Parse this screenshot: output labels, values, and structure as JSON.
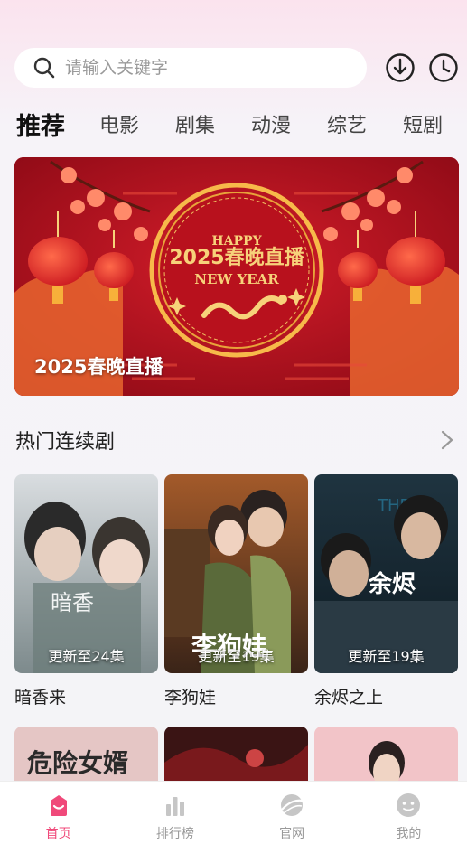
{
  "search": {
    "placeholder": "请输入关键字"
  },
  "tabs": [
    {
      "label": "推荐"
    },
    {
      "label": "电影"
    },
    {
      "label": "剧集"
    },
    {
      "label": "动漫"
    },
    {
      "label": "综艺"
    },
    {
      "label": "短剧"
    }
  ],
  "banner": {
    "caption": "2025春晚直播",
    "art_top": "HAPPY",
    "art_main": "2025春晚直播",
    "art_sub": "NEW YEAR"
  },
  "section": {
    "title": "热门连续剧"
  },
  "shows": [
    {
      "title": "暗香来",
      "badge": "更新至24集"
    },
    {
      "title": "李狗娃",
      "badge": "更新至19集"
    },
    {
      "title": "余烬之上",
      "badge": "更新至19集"
    }
  ],
  "next_row": [
    {
      "art_text": "危险女婿"
    }
  ],
  "bottom_nav": [
    {
      "label": "首页"
    },
    {
      "label": "排行榜"
    },
    {
      "label": "官网"
    },
    {
      "label": "我的"
    }
  ],
  "colors": {
    "accent": "#f0497a",
    "banner_red": "#b30f1e",
    "gold": "#f7d27a"
  }
}
